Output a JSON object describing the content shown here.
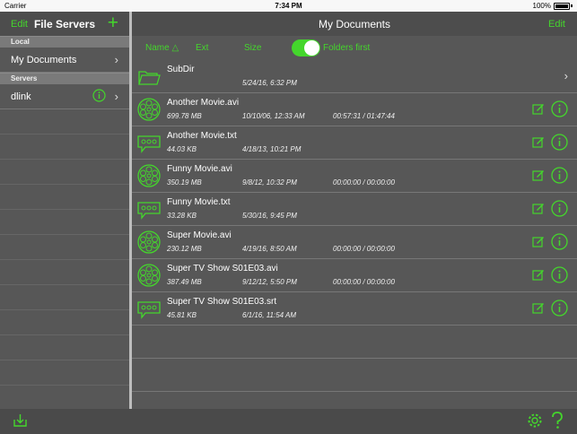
{
  "status": {
    "carrier": "Carrier",
    "time": "7:34 PM",
    "battery": "100%"
  },
  "left": {
    "edit_label": "Edit",
    "title": "File Servers",
    "add_label": "+",
    "sections": [
      {
        "header": "Local",
        "items": [
          {
            "label": "My Documents"
          }
        ]
      },
      {
        "header": "Servers",
        "items": [
          {
            "label": "dlink"
          }
        ]
      }
    ]
  },
  "right": {
    "title": "My Documents",
    "edit_label": "Edit",
    "sort": {
      "name": "Name △",
      "ext": "Ext",
      "size": "Size",
      "folders_first": "Folders first"
    },
    "files": [
      {
        "name": "SubDir",
        "size": "",
        "date": "5/24/16, 6:32 PM",
        "duration": "",
        "icon": "folder-icon"
      },
      {
        "name": "Another Movie.avi",
        "size": "699.78 MB",
        "date": "10/10/06, 12:33 AM",
        "duration": "00:57:31 / 01:47:44",
        "icon": "film-reel-icon"
      },
      {
        "name": "Another Movie.txt",
        "size": "44.03 KB",
        "date": "4/18/13, 10:21 PM",
        "duration": "",
        "icon": "subtitle-icon"
      },
      {
        "name": "Funny Movie.avi",
        "size": "350.19 MB",
        "date": "9/8/12, 10:32 PM",
        "duration": "00:00:00 / 00:00:00",
        "icon": "film-reel-icon"
      },
      {
        "name": "Funny Movie.txt",
        "size": "33.28 KB",
        "date": "5/30/16, 9:45 PM",
        "duration": "",
        "icon": "subtitle-icon"
      },
      {
        "name": "Super Movie.avi",
        "size": "230.12 MB",
        "date": "4/19/16, 8:50 AM",
        "duration": "00:00:00 / 00:00:00",
        "icon": "film-reel-icon"
      },
      {
        "name": "Super TV Show S01E03.avi",
        "size": "387.49 MB",
        "date": "9/12/12, 5:50 PM",
        "duration": "00:00:00 / 00:00:00",
        "icon": "film-reel-icon"
      },
      {
        "name": "Super TV Show S01E03.srt",
        "size": "45.81 KB",
        "date": "6/1/16, 11:54 AM",
        "duration": "",
        "icon": "subtitle-icon"
      }
    ]
  },
  "colors": {
    "accent": "#44d62c",
    "background": "#575757"
  }
}
